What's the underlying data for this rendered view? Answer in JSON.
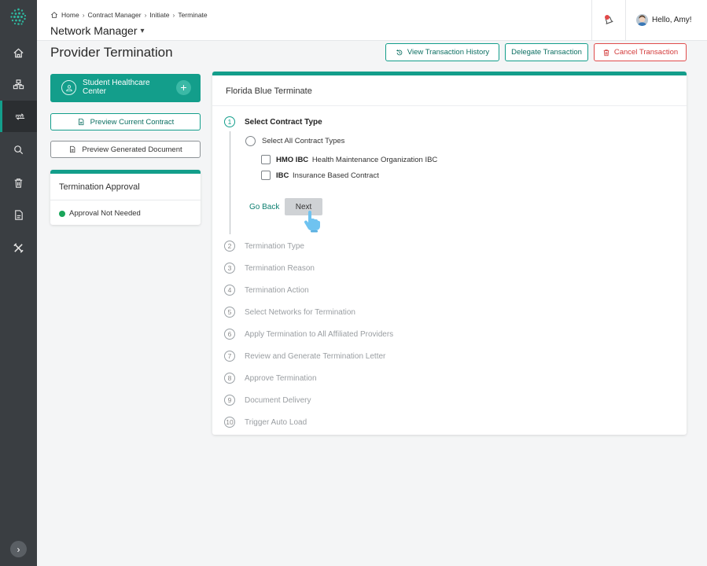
{
  "header": {
    "breadcrumb": [
      "Home",
      "Contract Manager",
      "Initiate",
      "Terminate"
    ],
    "app_title": "Network Manager",
    "greeting": "Hello, Amy!"
  },
  "page": {
    "title": "Provider Termination",
    "actions": {
      "view_history": "View Transaction History",
      "delegate": "Delegate Transaction",
      "cancel": "Cancel Transaction"
    }
  },
  "sidebar": {
    "icons": [
      "home-icon",
      "network-icon",
      "transaction-icon",
      "search-icon",
      "trash-icon",
      "document-icon",
      "tools-icon"
    ],
    "active_index": 2
  },
  "provider": {
    "name": "Student Healthcare Center",
    "add": "+"
  },
  "preview": {
    "current_contract": "Preview Current Contract",
    "generated_document": "Preview Generated Document"
  },
  "approval": {
    "title": "Termination Approval",
    "status": "Approval Not Needed",
    "status_color": "#19a55a"
  },
  "wizard": {
    "title": "Florida Blue Terminate",
    "steps": [
      {
        "num": "1",
        "label": "Select Contract Type"
      },
      {
        "num": "2",
        "label": "Termination Type"
      },
      {
        "num": "3",
        "label": "Termination Reason"
      },
      {
        "num": "4",
        "label": "Termination Action"
      },
      {
        "num": "5",
        "label": "Select Networks for Termination"
      },
      {
        "num": "6",
        "label": "Apply Termination to All Affiliated Providers"
      },
      {
        "num": "7",
        "label": "Review and Generate Termination Letter"
      },
      {
        "num": "8",
        "label": "Approve Termination"
      },
      {
        "num": "9",
        "label": "Document Delivery"
      },
      {
        "num": "10",
        "label": "Trigger Auto Load"
      }
    ],
    "select_all": "Select All Contract Types",
    "contract_types": [
      {
        "code": "HMO IBC",
        "desc": "Health Maintenance Organization IBC"
      },
      {
        "code": "IBC",
        "desc": "Insurance Based Contract"
      }
    ],
    "go_back": "Go Back",
    "next": "Next"
  },
  "colors": {
    "accent": "#139e8b",
    "danger": "#d33b3b",
    "rail": "#3a3e42"
  }
}
